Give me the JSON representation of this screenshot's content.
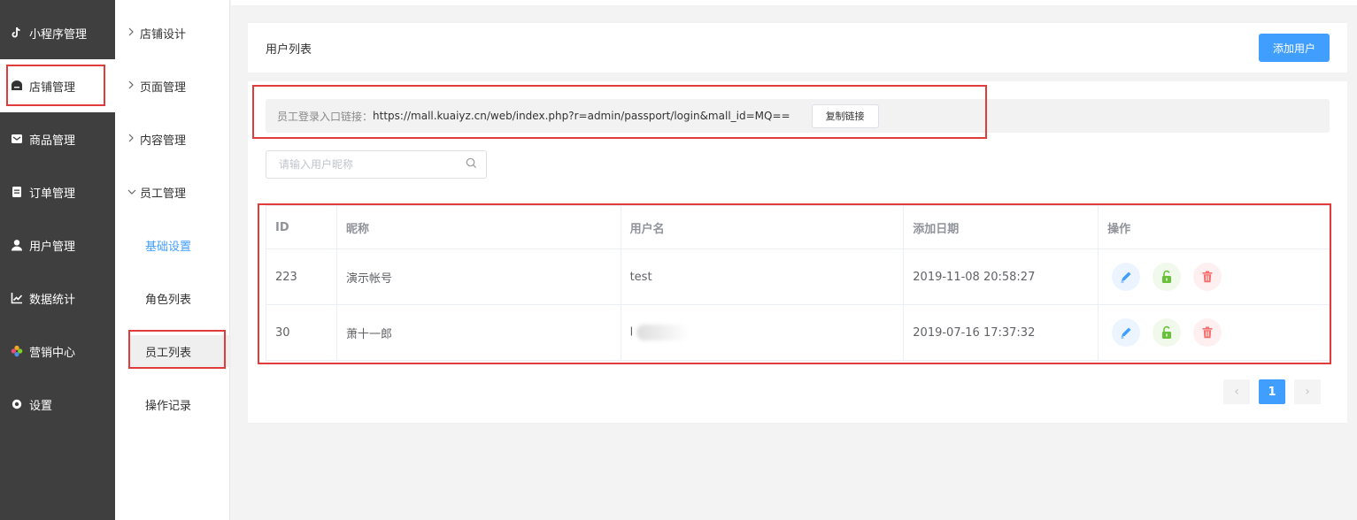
{
  "sidebar": {
    "items": [
      {
        "label": "小程序管理",
        "icon": "tiktok-icon"
      },
      {
        "label": "店铺管理",
        "icon": "store-icon"
      },
      {
        "label": "商品管理",
        "icon": "mail-icon"
      },
      {
        "label": "订单管理",
        "icon": "clipboard-icon"
      },
      {
        "label": "用户管理",
        "icon": "user-icon"
      },
      {
        "label": "数据统计",
        "icon": "chart-icon"
      },
      {
        "label": "营销中心",
        "icon": "flower-icon"
      },
      {
        "label": "设置",
        "icon": "gear-icon"
      }
    ]
  },
  "submenu": {
    "groups": [
      {
        "label": "店铺设计",
        "expanded": false
      },
      {
        "label": "页面管理",
        "expanded": false
      },
      {
        "label": "内容管理",
        "expanded": false
      },
      {
        "label": "员工管理",
        "expanded": true
      }
    ],
    "children": [
      "基础设置",
      "角色列表",
      "员工列表",
      "操作记录"
    ]
  },
  "header": {
    "title": "用户列表",
    "add_button": "添加用户"
  },
  "login_link": {
    "label": "员工登录入口链接：",
    "url": "https://mall.kuaiyz.cn/web/index.php?r=admin/passport/login&mall_id=MQ==",
    "copy_button": "复制链接"
  },
  "search": {
    "placeholder": "请输入用户昵称"
  },
  "table": {
    "columns": [
      "ID",
      "昵称",
      "用户名",
      "添加日期",
      "操作"
    ],
    "rows": [
      {
        "id": "223",
        "nickname": "演示帐号",
        "username": "test",
        "date": "2019-11-08 20:58:27"
      },
      {
        "id": "30",
        "nickname": "萧十一郎",
        "username": "l",
        "date": "2019-07-16 17:37:32"
      }
    ]
  },
  "pagination": {
    "prev": "‹",
    "current": "1",
    "next": "›"
  },
  "colors": {
    "primary": "#409eff",
    "sidebar_bg": "#3f3f3f",
    "annotation_red": "#e03c3c",
    "edit_blue": "#409eff",
    "unlock_green": "#67c23a",
    "delete_red": "#f56c6c"
  }
}
